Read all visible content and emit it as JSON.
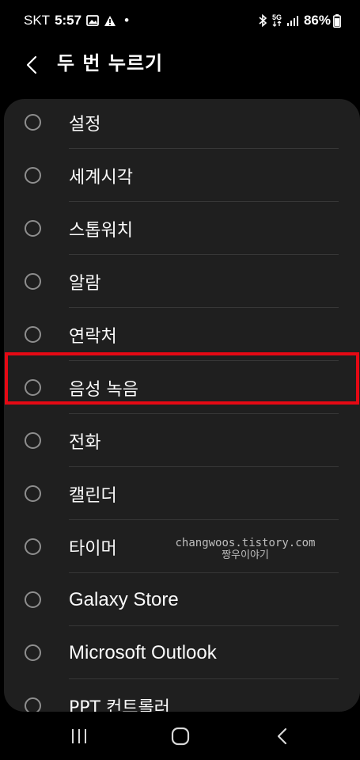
{
  "status_bar": {
    "carrier": "SKT",
    "time": "5:57",
    "dot": "•",
    "battery": "86%",
    "network_label": "5G"
  },
  "header": {
    "title": "두 번 누르기"
  },
  "list": {
    "items": [
      {
        "label": "설정",
        "selected": false
      },
      {
        "label": "세계시각",
        "selected": false
      },
      {
        "label": "스톱워치",
        "selected": false
      },
      {
        "label": "알람",
        "selected": false
      },
      {
        "label": "연락처",
        "selected": false
      },
      {
        "label": "음성 녹음",
        "selected": false
      },
      {
        "label": "전화",
        "selected": false
      },
      {
        "label": "캘린더",
        "selected": false
      },
      {
        "label": "타이머",
        "selected": false
      },
      {
        "label": "Galaxy Store",
        "selected": false
      },
      {
        "label": "Microsoft Outlook",
        "selected": false
      },
      {
        "label": "PPT 컨트롤러",
        "selected": false
      }
    ],
    "highlighted_item": "음성 녹음",
    "highlight_color": "#e50914"
  },
  "watermark": {
    "line1": "changwoos.tistory.com",
    "line2": "짱우이야기"
  },
  "nav_bar": {
    "recents": "recents-icon",
    "home": "home-icon",
    "back": "back-icon"
  }
}
